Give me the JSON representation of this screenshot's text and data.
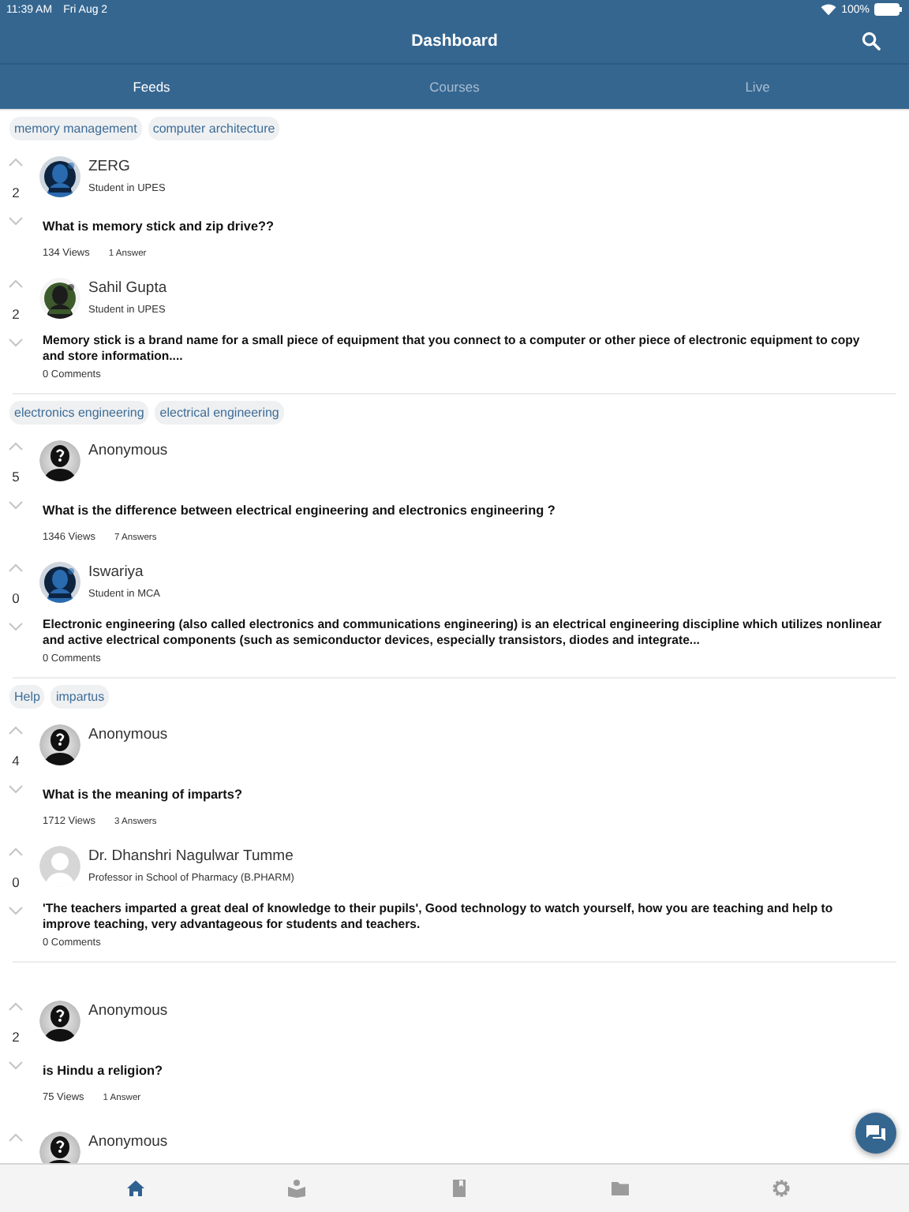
{
  "status_bar": {
    "time": "11:39 AM",
    "date": "Fri Aug 2",
    "battery": "100%"
  },
  "header": {
    "title": "Dashboard"
  },
  "tabs": [
    {
      "label": "Feeds",
      "selected": true
    },
    {
      "label": "Courses",
      "selected": false
    },
    {
      "label": "Live",
      "selected": false
    }
  ],
  "feed": [
    {
      "tags": [
        "memory management",
        "computer architecture"
      ],
      "question": {
        "votes": "2",
        "author": "ZERG",
        "subtitle": "Student in UPES",
        "title": "What is memory stick and zip drive??",
        "views": "134 Views",
        "answers": "1 Answer"
      },
      "answer": {
        "votes": "2",
        "author": "Sahil Gupta",
        "subtitle": "Student in UPES",
        "text": "Memory stick is a brand name for a small piece of equipment that you connect to a computer or other piece of electronic equipment to copy and store information....",
        "comments": "0 Comments"
      }
    },
    {
      "tags": [
        "electronics engineering",
        "electrical engineering"
      ],
      "question": {
        "votes": "5",
        "author": "Anonymous",
        "avatar": {
          "kind": "anonymous"
        },
        "title": "What is the difference between electrical engineering and electronics engineering ?",
        "views": "1346 Views",
        "answers": "7 Answers"
      },
      "answer": {
        "votes": "0",
        "author": "Iswariya",
        "subtitle": "Student in MCA",
        "text": "Electronic engineering (also called electronics and communications engineering) is an electrical engineering discipline which utilizes nonlinear and active electrical components (such as semiconductor devices, especially transistors, diodes and integrate...",
        "comments": "0 Comments"
      }
    },
    {
      "tags": [
        "Help",
        "impartus"
      ],
      "question": {
        "votes": "4",
        "author": "Anonymous",
        "avatar": {
          "kind": "anonymous"
        },
        "title": "What is the meaning of imparts?",
        "views": "1712 Views",
        "answers": "3 Answers"
      },
      "answer": {
        "votes": "0",
        "author": "Dr. Dhanshri Nagulwar Tumme",
        "avatar": {
          "kind": "default"
        },
        "subtitle": "Professor in School of Pharmacy (B.PHARM)",
        "text": "'The teachers imparted a great deal of knowledge to their pupils', Good technology to watch yourself, how you are teaching and help to  improve teaching, very advantageous for students and teachers.",
        "comments": "0 Comments"
      }
    },
    {
      "question": {
        "votes": "2",
        "author": "Anonymous",
        "avatar": {
          "kind": "anonymous"
        },
        "title": "is Hindu a religion?",
        "views": "75 Views",
        "answers": "1 Answer"
      }
    },
    {
      "question": {
        "author": "Anonymous",
        "avatar": {
          "kind": "anonymous"
        }
      }
    }
  ],
  "bottom_nav": [
    {
      "kind": "home",
      "selected": true
    },
    {
      "kind": "learn",
      "selected": false
    },
    {
      "kind": "book",
      "selected": false
    },
    {
      "kind": "folder",
      "selected": false
    },
    {
      "kind": "settings",
      "selected": false
    }
  ]
}
